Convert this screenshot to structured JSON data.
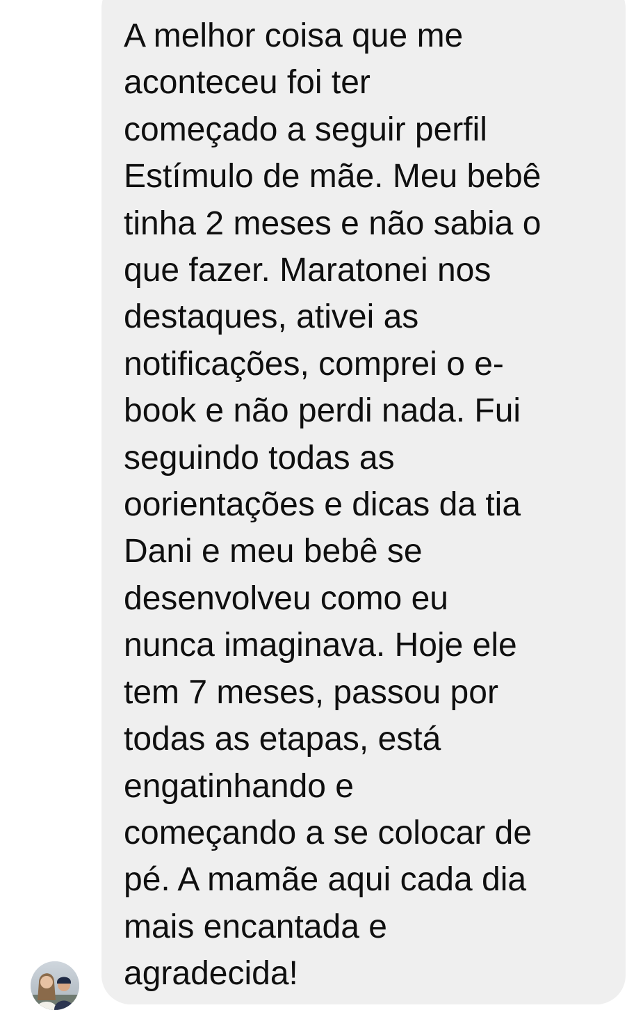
{
  "message": {
    "lines": [
      "A melhor coisa que me",
      "aconteceu foi ter",
      "começado a seguir perfil",
      "Estímulo de mãe. Meu bebê",
      "tinha 2 meses e não sabia o",
      "que fazer. Maratonei nos",
      "destaques, ativei as",
      "notificações, comprei o e-",
      "book e não perdi nada. Fui",
      "seguindo todas as",
      "oorientações e dicas da tia",
      "Dani e meu bebê se",
      "desenvolveu como eu",
      "nunca imaginava. Hoje ele",
      "tem 7 meses, passou por",
      "todas as etapas, está",
      "engatinhando e",
      "começando a se colocar de",
      "pé. A mamãe aqui cada dia",
      "mais encantada e",
      "agradecida!"
    ]
  },
  "colors": {
    "bubble_background": "#efefef",
    "text": "#0f0f0f",
    "page_background": "#ffffff"
  },
  "sender": {
    "avatar_icon": "profile-photo-icon"
  }
}
